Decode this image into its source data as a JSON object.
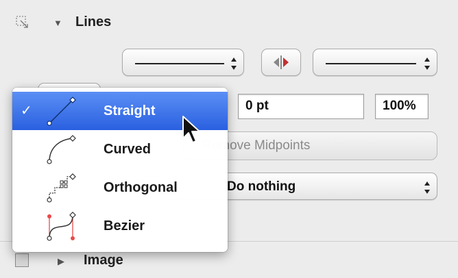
{
  "lines_section": {
    "title": "Lines",
    "opacity_value": "100%",
    "width_value": "0 pt",
    "remove_midpoints_label": "Remove Midpoints",
    "do_nothing_value": "Do nothing"
  },
  "line_type_menu": {
    "items": [
      {
        "label": "Straight",
        "icon": "straight-line-icon",
        "selected": true
      },
      {
        "label": "Curved",
        "icon": "curved-line-icon",
        "selected": false
      },
      {
        "label": "Orthogonal",
        "icon": "orthogonal-line-icon",
        "selected": false
      },
      {
        "label": "Bezier",
        "icon": "bezier-line-icon",
        "selected": false
      }
    ],
    "check_glyph": "✓"
  },
  "image_section": {
    "title": "Image"
  },
  "colors": {
    "selection": "#3a6fe8",
    "background": "#ececec"
  }
}
